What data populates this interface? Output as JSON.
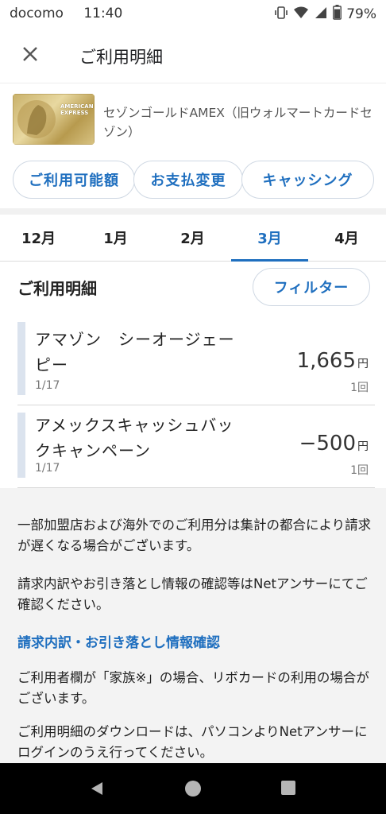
{
  "status_bar": {
    "carrier": "docomo",
    "time": "11:40",
    "battery": "79%"
  },
  "header": {
    "title": "ご利用明細"
  },
  "card": {
    "name": "セゾンゴールドAMEX（旧ウォルマートカードセゾン）",
    "brand_line1": "AMERICAN",
    "brand_line2": "EXPRESS"
  },
  "actions": [
    {
      "label": "ご利用可能額"
    },
    {
      "label": "お支払変更"
    },
    {
      "label": "キャッシング"
    }
  ],
  "months": [
    {
      "label": "12月"
    },
    {
      "label": "1月"
    },
    {
      "label": "2月"
    },
    {
      "label": "3月",
      "active": true
    },
    {
      "label": "4月"
    }
  ],
  "section": {
    "title": "ご利用明細",
    "filter_label": "フィルター"
  },
  "transactions": [
    {
      "description": "アマゾン　シーオージェーピー",
      "date": "1/17",
      "amount": "1,665",
      "unit": "円",
      "count": "1回"
    },
    {
      "description": "アメックスキャッシュバックキャンペーン",
      "date": "1/17",
      "amount": "−500",
      "unit": "円",
      "count": "1回"
    }
  ],
  "notes": {
    "note1": "一部加盟店および海外でのご利用分は集計の都合により請求が遅くなる場合がございます。",
    "note2": " 請求内訳やお引き落とし情報の確認等はNetアンサーにてご確認ください。",
    "link": "請求内訳・お引き落とし情報確認",
    "note3": "ご利用者欄が「家族※」の場合、リボカードの利用の場合がございます。",
    "note4": "ご利用明細のダウンロードは、パソコンよりNetアンサーにログインのうえ行ってください。"
  },
  "icons": {
    "close": "close-icon",
    "wifi": "wifi-icon",
    "signal": "signal-icon",
    "battery": "battery-icon"
  },
  "colors": {
    "accent": "#1f6fbf",
    "card_gold": "#c9b16a"
  }
}
